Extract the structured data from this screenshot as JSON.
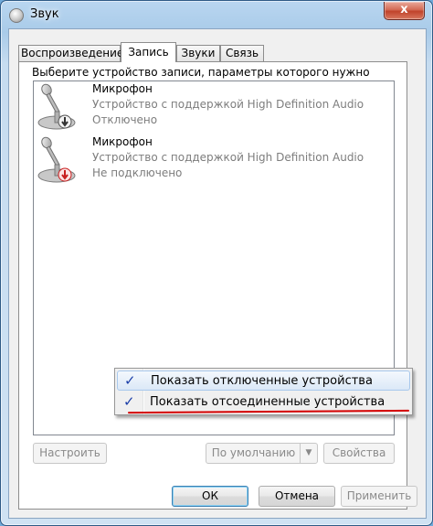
{
  "window": {
    "title": "Звук",
    "close_label": "x"
  },
  "tabs": [
    {
      "label": "Воспроизведение",
      "active": false
    },
    {
      "label": "Запись",
      "active": true
    },
    {
      "label": "Звуки",
      "active": false
    },
    {
      "label": "Связь",
      "active": false
    }
  ],
  "panel": {
    "instruction": "Выберите устройство записи, параметры которого нужно изменить:",
    "devices": [
      {
        "name": "Микрофон",
        "description": "Устройство с поддержкой High Definition Audio",
        "status": "Отключено",
        "badge_icon": "down-arrow-disabled-icon"
      },
      {
        "name": "Микрофон",
        "description": "Устройство с поддержкой High Definition Audio",
        "status": "Не подключено",
        "badge_icon": "down-arrow-unplugged-icon"
      }
    ]
  },
  "context_menu": {
    "items": [
      {
        "label": "Показать отключенные устройства",
        "checked": true,
        "highlighted": true
      },
      {
        "label": "Показать отсоединенные устройства",
        "checked": true,
        "highlighted": false
      }
    ],
    "check_glyph": "✓"
  },
  "panel_buttons": {
    "configure": "Настроить",
    "default": "По умолчанию",
    "default_arrow": "▼",
    "properties": "Свойства"
  },
  "dialog_buttons": {
    "ok": "ОК",
    "cancel": "Отмена",
    "apply": "Применить"
  },
  "colors": {
    "annotation_underline": "#d40000",
    "check_color": "#1c3fa8",
    "disabled_badge": "#555555",
    "unplugged_badge": "#c81e1e"
  }
}
